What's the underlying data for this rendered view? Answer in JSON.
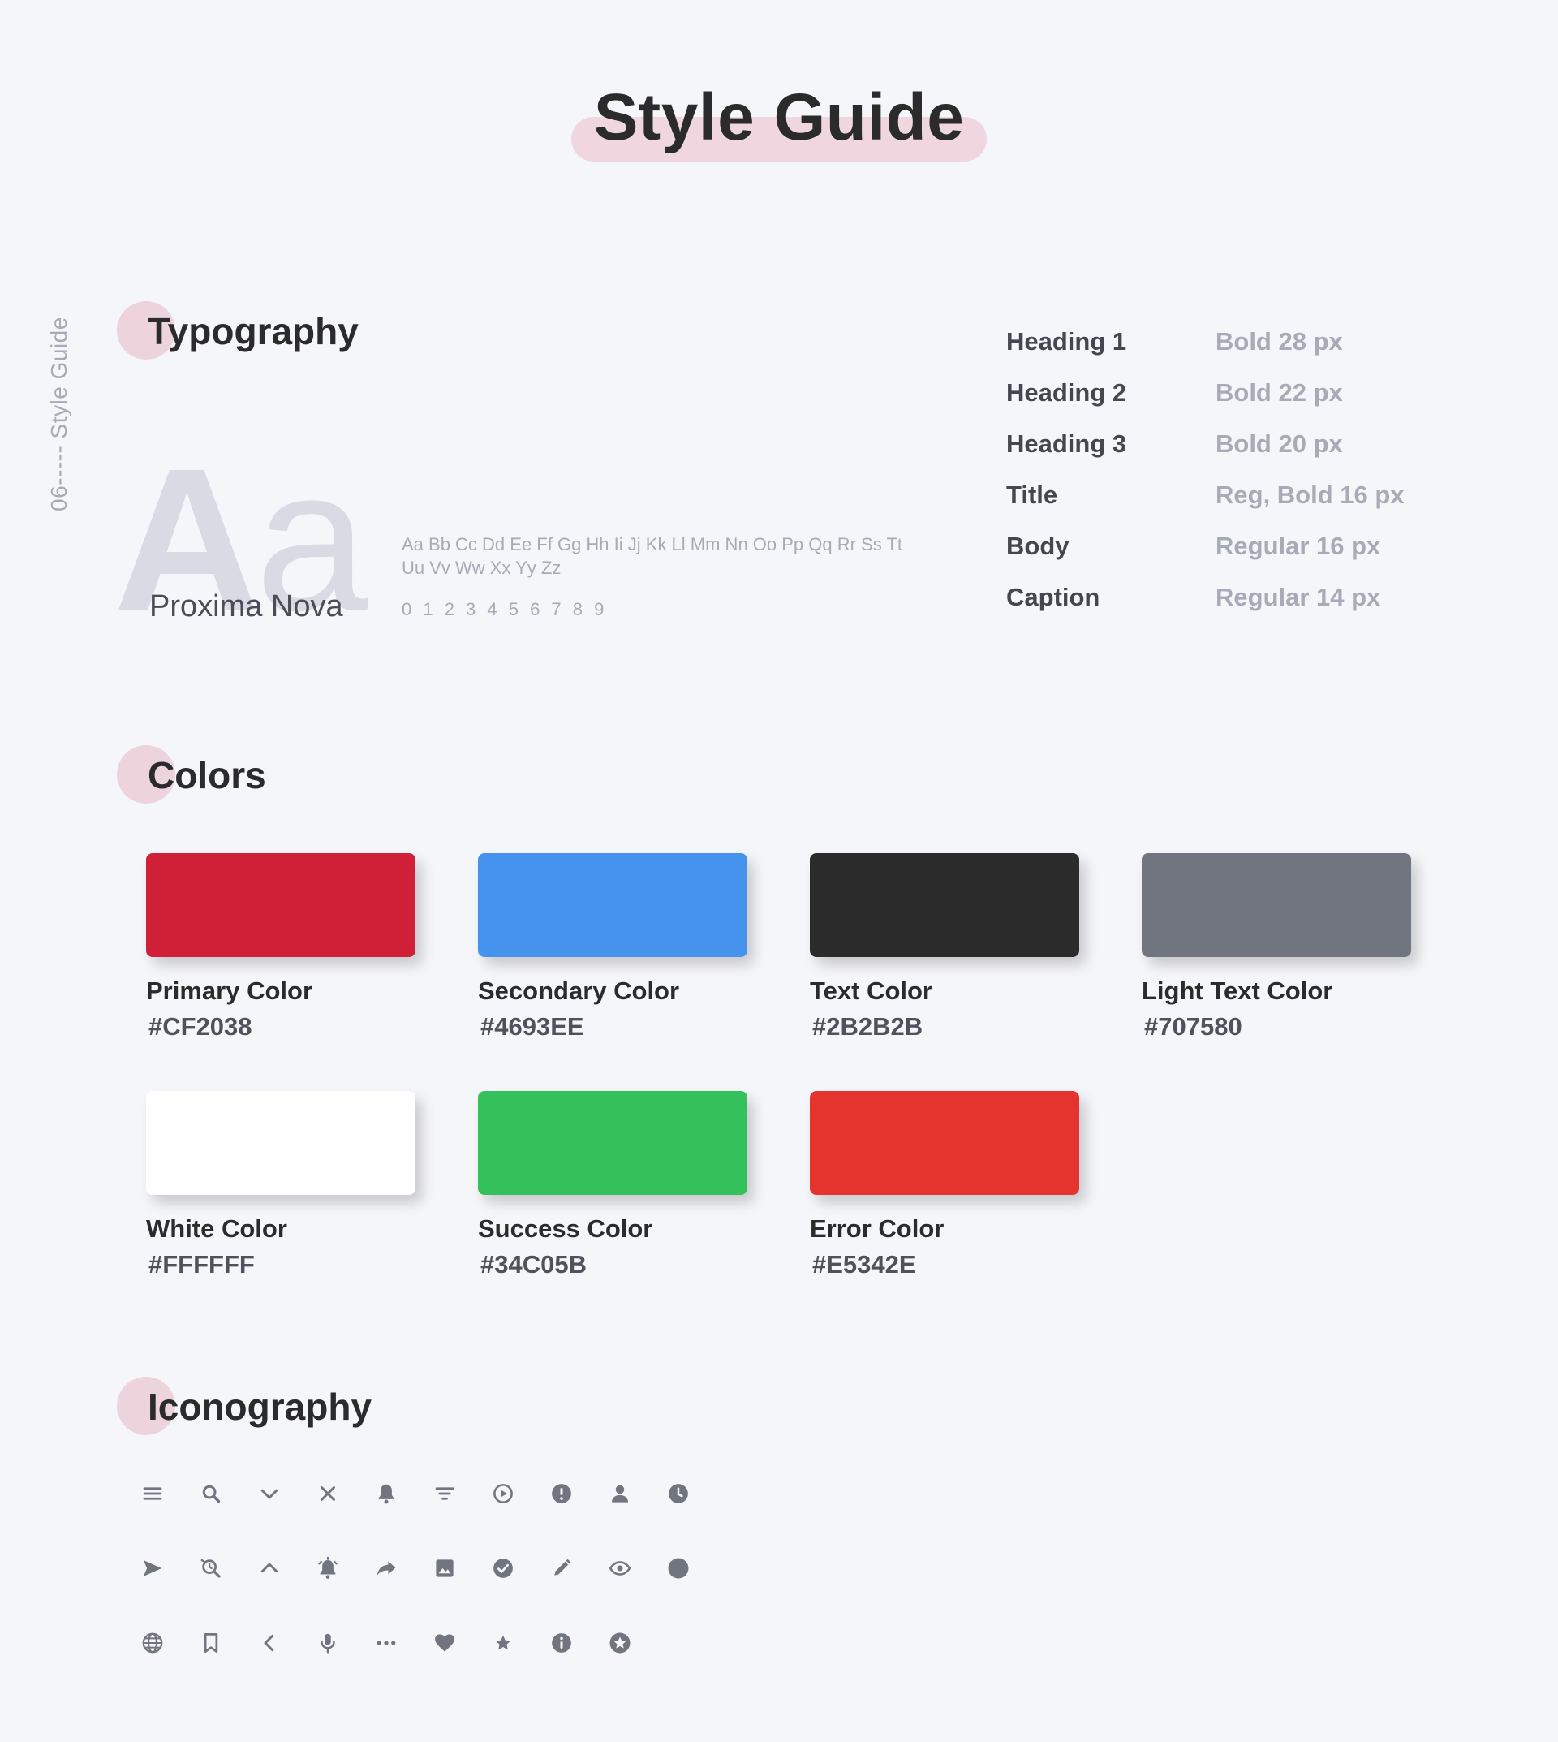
{
  "header": {
    "title": "Style Guide"
  },
  "side_label": "06----- Style Guide",
  "typography": {
    "section_title": "Typography",
    "sample_glyph_upper": "A",
    "sample_glyph_lower": "a",
    "font_name": "Proxima Nova",
    "alphabet": "Aa Bb Cc Dd Ee Ff Gg Hh Ii Jj Kk Ll Mm Nn Oo Pp Qq Rr Ss Tt Uu Vv Ww Xx Yy Zz",
    "digits": "0 1 2 3 4 5 6 7 8 9",
    "styles": [
      {
        "name": "Heading 1",
        "spec": "Bold 28 px"
      },
      {
        "name": "Heading 2",
        "spec": "Bold 22 px"
      },
      {
        "name": "Heading 3",
        "spec": "Bold 20 px"
      },
      {
        "name": "Title",
        "spec": "Reg, Bold 16 px"
      },
      {
        "name": "Body",
        "spec": "Regular 16 px"
      },
      {
        "name": "Caption",
        "spec": "Regular 14 px"
      }
    ]
  },
  "colors": {
    "section_title": "Colors",
    "swatches": [
      {
        "name": "Primary Color",
        "hex": "#CF2038"
      },
      {
        "name": "Secondary Color",
        "hex": "#4693EE"
      },
      {
        "name": "Text Color",
        "hex": "#2B2B2B"
      },
      {
        "name": "Light Text Color",
        "hex": "#707580"
      },
      {
        "name": "White Color",
        "hex": "#FFFFFF"
      },
      {
        "name": "Success Color",
        "hex": "#34C05B"
      },
      {
        "name": "Error Color",
        "hex": "#E5342E"
      }
    ]
  },
  "iconography": {
    "section_title": "Iconography",
    "icon_color": "#707580",
    "rows": [
      [
        "menu-icon",
        "search-icon",
        "chevron-down-icon",
        "close-icon",
        "bell-icon",
        "filter-icon",
        "play-circle-icon",
        "alert-circle-icon",
        "user-icon",
        "clock-icon"
      ],
      [
        "send-icon",
        "zoom-icon",
        "chevron-up-icon",
        "bell-ring-icon",
        "share-icon",
        "image-icon",
        "check-circle-icon",
        "pencil-icon",
        "eye-icon",
        "circle-icon"
      ],
      [
        "globe-icon",
        "bookmark-icon",
        "chevron-left-icon",
        "microphone-icon",
        "more-horizontal-icon",
        "heart-icon",
        "star-icon",
        "info-circle-icon",
        "star-circle-icon"
      ]
    ]
  }
}
